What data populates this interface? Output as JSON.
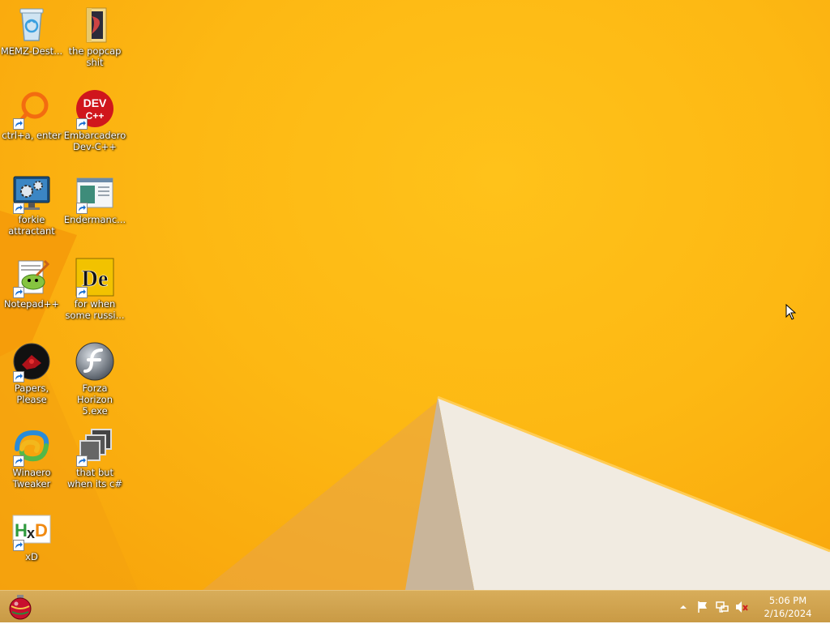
{
  "desktop": {
    "icons": [
      {
        "label": "MEMZ-Dest...",
        "icon": "recycle-bin-icon"
      },
      {
        "label": "the popcap shit",
        "icon": "folder-icon"
      },
      {
        "label": "ctrl+a, enter",
        "icon": "ring-icon"
      },
      {
        "label": "Embarcadero Dev-C++",
        "icon": "dev-cpp-icon"
      },
      {
        "label": "forkie attractant",
        "icon": "monitor-gears-icon"
      },
      {
        "label": "Endermanc...",
        "icon": "window-app-icon"
      },
      {
        "label": "Notepad++",
        "icon": "notepadpp-icon"
      },
      {
        "label": "for when some russi...",
        "icon": "de-icon"
      },
      {
        "label": "Papers, Please",
        "icon": "papers-please-icon"
      },
      {
        "label": "Forza Horizon 5.exe",
        "icon": "flash-icon"
      },
      {
        "label": "Winaero Tweaker",
        "icon": "winaero-icon"
      },
      {
        "label": "that but when its c#",
        "icon": "stacked-windows-icon"
      },
      {
        "label": "xD",
        "icon": "hxd-icon"
      }
    ]
  },
  "dev_icon_text": "DEV C++",
  "de_icon_text": "De",
  "hxd_icon_text": "HxD",
  "taskbar": {
    "start_icon": "christmas-ornament-icon",
    "tray_icons": [
      "show-hidden-icons-arrow",
      "action-center-flag-icon",
      "network-icon",
      "volume-muted-icon"
    ],
    "time": "5:06 PM",
    "date": "2/16/2024"
  }
}
